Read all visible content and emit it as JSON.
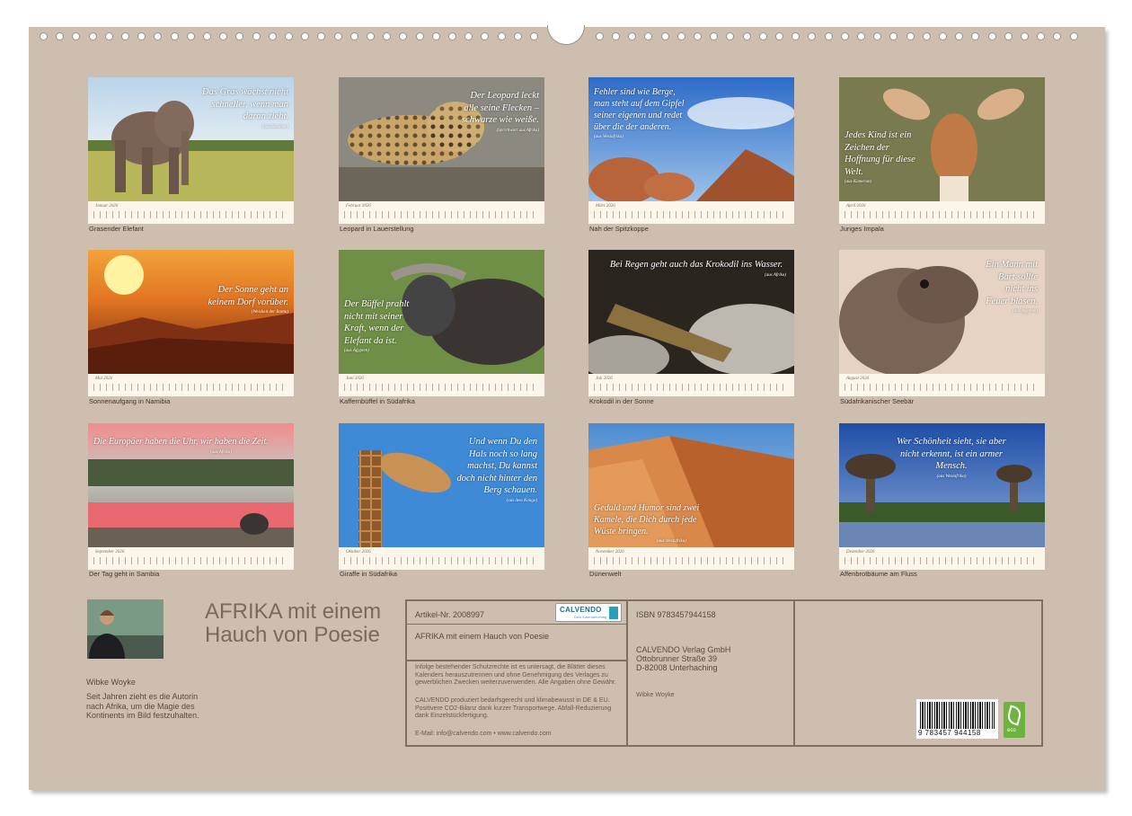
{
  "months": [
    {
      "month": "Januar 2026",
      "caption": "Grasender Elefant",
      "quote": "Das Gras wächst nicht schneller, wenn man daran zieht.",
      "source": "(aus Sansibar)"
    },
    {
      "month": "Februar 2026",
      "caption": "Leopard in Lauerstellung",
      "quote": "Der Leopard leckt alle seine Flecken – schwarze wie weiße.",
      "source": "(Sprichwort aus Afrika)"
    },
    {
      "month": "März 2026",
      "caption": "Nah der Spitzkoppe",
      "quote": "Fehler sind wie Berge, man steht auf dem Gipfel seiner eigenen und redet über die der anderen.",
      "source": "(aus Westafrika)"
    },
    {
      "month": "April 2026",
      "caption": "Junges Impala",
      "quote": "Jedes Kind ist ein Zeichen der Hoffnung für diese Welt.",
      "source": "(aus Kamerun)"
    },
    {
      "month": "Mai 2026",
      "caption": "Sonnenaufgang in Namibia",
      "quote": "Der Sonne geht an keinem Dorf vorüber.",
      "source": "(Weisheit der Bantu)"
    },
    {
      "month": "Juni 2026",
      "caption": "Kaffernbüffel in Südafrika",
      "quote": "Der Büffel prahlt nicht mit seiner Kraft, wenn der Elefant da ist.",
      "source": "(aus Ägypten)"
    },
    {
      "month": "Juli 2026",
      "caption": "Krokodil in der Sonne",
      "quote": "Bei Regen geht auch das Krokodil ins Wasser.",
      "source": "(aus Afrika)"
    },
    {
      "month": "August 2026",
      "caption": "Südafrikanischer Seebär",
      "quote": "Ein Mann mit Bart sollte nicht ins Feuer blasen.",
      "source": "(aus Ägypten)"
    },
    {
      "month": "September 2026",
      "caption": "Der Tag geht in Sambia",
      "quote": "Die Europäer haben die Uhr, wir haben die Zeit.",
      "source": "(aus Afrika)"
    },
    {
      "month": "Oktober 2026",
      "caption": "Giraffe in Südafrika",
      "quote": "Und wenn Du den Hals noch so lang machst, Du kannst doch nicht hinter den Berg schauen.",
      "source": "(aus dem Kongo)"
    },
    {
      "month": "November 2026",
      "caption": "Dünenwelt",
      "quote": "Geduld und Humor sind zwei Kamele, die Dich durch jede Wüste bringen.",
      "source": "(aus Westafrika)"
    },
    {
      "month": "Dezember 2026",
      "caption": "Affenbrotbäume am Fluss",
      "quote": "Wer Schönheit sieht, sie aber nicht erkennt, ist ein armer Mensch.",
      "source": "(aus Westafrika)"
    }
  ],
  "cover": {
    "title": "AFRIKA mit einem Hauch von Poesie",
    "author": "Wibke Woyke",
    "bio": "Seit Jahren zieht es die Autorin nach Afrika, um die Magie des Kontinents im Bild festzuhalten."
  },
  "info": {
    "article": "Artikel-Nr. 2008997",
    "calvendo_logo": "CALVENDO",
    "calvendo_sub": "Dein Kalenderverlag",
    "title": "AFRIKA mit einem Hauch von Poesie",
    "legal1": "Infolge bestehender Schutzrechte ist es untersagt, die Blätter dieses Kalenders herauszutrennen und ohne Genehmigung des Verlages zu gewerblichen Zwecken weiterzuverwenden. Alle Angaben ohne Gewähr.",
    "legal2": "CALVENDO produziert bedarfsgerecht und klimabewusst in DE & EU. Positivere CO2-Bilanz dank kurzer Transportwege. Abfall-Reduzierung dank Einzelstückfertigung.",
    "contact": "E-Mail: info@calvendo.com • www.calvendo.com",
    "isbn": "ISBN 9783457944158",
    "publisher1": "CALVENDO Verlag GmbH",
    "publisher2": "Ottobrunner Straße 39",
    "publisher3": "D-82008 Unterhaching",
    "author_small": "Wibke Woyke",
    "barcode": "9 783457 944158",
    "eco": "eco"
  },
  "colors": {
    "sheet": "#cdbeb0",
    "strip": "#fbf5ea",
    "frame": "#7f7061"
  }
}
